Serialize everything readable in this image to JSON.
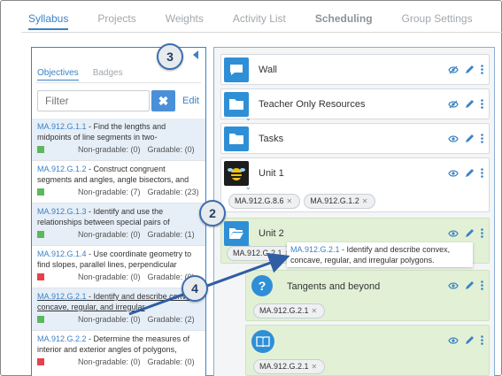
{
  "nav": {
    "tabs": [
      {
        "label": "Syllabus"
      },
      {
        "label": "Projects"
      },
      {
        "label": "Weights"
      },
      {
        "label": "Activity List"
      },
      {
        "label": "Scheduling"
      },
      {
        "label": "Group Settings"
      }
    ]
  },
  "left": {
    "tabs": [
      {
        "label": "Objectives"
      },
      {
        "label": "Badges"
      }
    ],
    "filter_placeholder": "Filter",
    "clear_label": "✖",
    "edit_label": "Edit",
    "standards": [
      {
        "code": "MA.912.G.1.1",
        "desc": " - Find the lengths and midpoints of line segments in two-",
        "status_color": "#5cb85c",
        "nongradable": "Non-gradable: (0)",
        "gradable": "Gradable: (0)"
      },
      {
        "code": "MA.912.G.1.2",
        "desc": " - Construct congruent segments and angles, angle bisectors, and",
        "status_color": "#5cb85c",
        "nongradable": "Non-gradable: (7)",
        "gradable": "Gradable: (23)"
      },
      {
        "code": "MA.912.G.1.3",
        "desc": " - Identify and use the relationships between special pairs of",
        "status_color": "#5cb85c",
        "nongradable": "Non-gradable: (0)",
        "gradable": "Gradable: (1)"
      },
      {
        "code": "MA.912.G.1.4",
        "desc": " - Use coordinate geometry to find slopes, parallel lines, perpendicular",
        "status_color": "#e8414d",
        "nongradable": "Non-gradable: (0)",
        "gradable": "Gradable: (0)"
      },
      {
        "code": "MA.912.G.2.1",
        "desc": " - Identify and describe convex, concave, regular, and irregular",
        "status_color": "#5cb85c",
        "nongradable": "Non-gradable: (0)",
        "gradable": "Gradable: (2)"
      },
      {
        "code": "MA.912.G.2.2",
        "desc": " - Determine the measures of interior and exterior angles of polygons,",
        "status_color": "#e8414d",
        "nongradable": "Non-gradable: (0)",
        "gradable": "Gradable: (0)"
      }
    ]
  },
  "cards": {
    "wall": {
      "title": "Wall"
    },
    "teacher": {
      "title": "Teacher Only Resources"
    },
    "tasks": {
      "title": "Tasks"
    },
    "unit1": {
      "title": "Unit 1",
      "chips": [
        "MA.912.G.8.6",
        "MA.912.G.1.2"
      ]
    },
    "unit2": {
      "title": "Unit 2",
      "chips": [
        "MA.912.G.2.1"
      ]
    },
    "tangents": {
      "title": "Tangents and beyond",
      "chips": [
        "MA.912.G.2.1"
      ]
    },
    "book": {
      "chips": [
        "MA.912.G.2.1"
      ]
    }
  },
  "tooltip": {
    "code": "MA.912.G.2.1",
    "text": " - Identify and describe convex, concave, regular, and irregular polygons."
  },
  "callouts": {
    "c2": "2",
    "c3": "3",
    "c4": "4"
  },
  "colors": {
    "accent": "#3b82c4",
    "icon_blue": "#2f8fd6",
    "highlight_green": "#e2f1d6"
  }
}
